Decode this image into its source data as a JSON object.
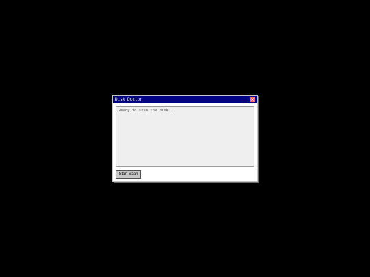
{
  "window": {
    "title": "Disk Doctor",
    "close_icon": "close-icon",
    "close_color": "#d01010",
    "titlebar_color": "#000080"
  },
  "output": {
    "text": "Ready to scan the disk..."
  },
  "actions": {
    "start_scan_label": "Start Scan"
  }
}
